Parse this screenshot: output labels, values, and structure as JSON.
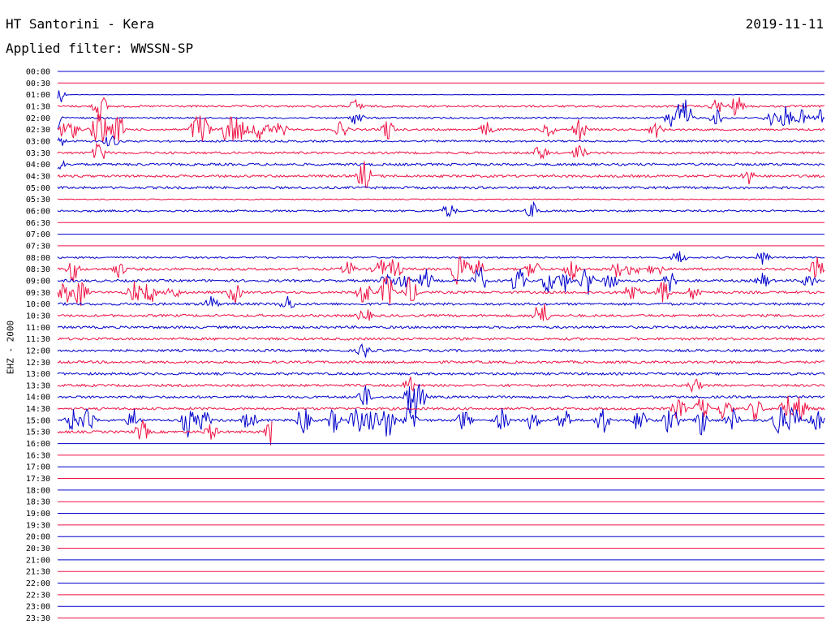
{
  "header": {
    "station": "HT Santorini - Kera",
    "date": "2019-11-11",
    "filter": "Applied filter: WWSSN-SP",
    "channel": "EHZ - 2000"
  },
  "colors": {
    "even_hour": "#0000cc",
    "half_hour": "#ee1144"
  },
  "chart_data": {
    "type": "line",
    "title": "HT Santorini - Kera",
    "subtitle": "Applied filter: WWSSN-SP",
    "date": "2019-11-11",
    "ylabel": "EHZ - 2000",
    "grid": false,
    "time_labels": [
      "00:00",
      "00:30",
      "01:00",
      "01:30",
      "02:00",
      "02:30",
      "03:00",
      "03:30",
      "04:00",
      "04:30",
      "05:00",
      "05:30",
      "06:00",
      "06:30",
      "07:00",
      "07:30",
      "08:00",
      "08:30",
      "09:00",
      "09:30",
      "10:00",
      "10:30",
      "11:00",
      "11:30",
      "12:00",
      "12:30",
      "13:00",
      "13:30",
      "14:00",
      "14:30",
      "15:00",
      "15:30",
      "16:00",
      "16:30",
      "17:00",
      "17:30",
      "18:00",
      "18:30",
      "19:00",
      "19:30",
      "20:00",
      "20:30",
      "21:00",
      "21:30",
      "22:00",
      "22:30",
      "23:00",
      "23:30"
    ],
    "series": [
      {
        "amplitude": 0,
        "events": []
      },
      {
        "amplitude": 0,
        "events": []
      },
      {
        "amplitude": 0.3,
        "events": [
          [
            0.0,
            3
          ]
        ]
      },
      {
        "amplitude": 1.2,
        "events": [
          [
            0.055,
            4
          ],
          [
            0.39,
            2
          ],
          [
            0.86,
            2
          ],
          [
            0.885,
            3
          ]
        ]
      },
      {
        "amplitude": 1.0,
        "events": [
          [
            0.0,
            3
          ],
          [
            0.39,
            2
          ],
          [
            0.8,
            2.5
          ],
          [
            0.81,
            3
          ],
          [
            0.82,
            4
          ],
          [
            0.86,
            2
          ],
          [
            0.93,
            2
          ],
          [
            0.95,
            3
          ],
          [
            0.97,
            2
          ],
          [
            0.995,
            2.5
          ]
        ]
      },
      {
        "amplitude": 1.2,
        "events": [
          [
            0.005,
            2
          ],
          [
            0.02,
            2
          ],
          [
            0.05,
            3
          ],
          [
            0.06,
            4
          ],
          [
            0.08,
            4
          ],
          [
            0.18,
            3
          ],
          [
            0.19,
            4
          ],
          [
            0.22,
            3
          ],
          [
            0.23,
            3
          ],
          [
            0.24,
            2
          ],
          [
            0.26,
            2
          ],
          [
            0.27,
            2
          ],
          [
            0.29,
            2
          ],
          [
            0.37,
            2
          ],
          [
            0.43,
            3
          ],
          [
            0.56,
            2
          ],
          [
            0.64,
            2
          ],
          [
            0.68,
            3
          ],
          [
            0.78,
            2
          ]
        ]
      },
      {
        "amplitude": 1.2,
        "events": [
          [
            0.0,
            3
          ],
          [
            0.07,
            2
          ]
        ]
      },
      {
        "amplitude": 1.4,
        "events": [
          [
            0.055,
            3
          ],
          [
            0.63,
            2
          ],
          [
            0.68,
            2
          ]
        ]
      },
      {
        "amplitude": 1.5,
        "events": [
          [
            0.0,
            2
          ]
        ]
      },
      {
        "amplitude": 1.5,
        "events": [
          [
            0.4,
            4
          ],
          [
            0.9,
            2
          ]
        ]
      },
      {
        "amplitude": 1.5,
        "events": []
      },
      {
        "amplitude": 0.6,
        "events": []
      },
      {
        "amplitude": 1.2,
        "events": [
          [
            0.51,
            2
          ],
          [
            0.62,
            2
          ]
        ]
      },
      {
        "amplitude": 0,
        "events": []
      },
      {
        "amplitude": 0,
        "events": []
      },
      {
        "amplitude": 0,
        "events": []
      },
      {
        "amplitude": 1.0,
        "events": [
          [
            0.81,
            2
          ],
          [
            0.92,
            2
          ]
        ]
      },
      {
        "amplitude": 1.5,
        "events": [
          [
            0.02,
            3
          ],
          [
            0.08,
            2
          ],
          [
            0.38,
            2
          ],
          [
            0.42,
            3
          ],
          [
            0.44,
            3
          ],
          [
            0.52,
            3
          ],
          [
            0.53,
            3
          ],
          [
            0.55,
            2
          ],
          [
            0.62,
            3
          ],
          [
            0.67,
            3
          ],
          [
            0.73,
            2
          ],
          [
            0.75,
            2
          ],
          [
            0.78,
            2
          ],
          [
            0.99,
            3
          ]
        ]
      },
      {
        "amplitude": 1.5,
        "events": [
          [
            0.43,
            2
          ],
          [
            0.45,
            3
          ],
          [
            0.48,
            3
          ],
          [
            0.55,
            4
          ],
          [
            0.6,
            4
          ],
          [
            0.64,
            3
          ],
          [
            0.66,
            3
          ],
          [
            0.69,
            4
          ],
          [
            0.72,
            3
          ],
          [
            0.8,
            3
          ],
          [
            0.92,
            2
          ],
          [
            0.98,
            2
          ]
        ]
      },
      {
        "amplitude": 1.5,
        "events": [
          [
            0.01,
            3
          ],
          [
            0.03,
            4
          ],
          [
            0.1,
            3
          ],
          [
            0.12,
            3
          ],
          [
            0.15,
            2
          ],
          [
            0.23,
            3
          ],
          [
            0.4,
            4
          ],
          [
            0.43,
            5
          ],
          [
            0.46,
            4
          ],
          [
            0.75,
            4
          ],
          [
            0.79,
            3
          ],
          [
            0.83,
            2
          ]
        ]
      },
      {
        "amplitude": 1.5,
        "events": [
          [
            0.2,
            2
          ],
          [
            0.3,
            2
          ]
        ]
      },
      {
        "amplitude": 1.5,
        "events": [
          [
            0.4,
            2
          ],
          [
            0.63,
            5
          ]
        ]
      },
      {
        "amplitude": 1.5,
        "events": []
      },
      {
        "amplitude": 1.5,
        "events": []
      },
      {
        "amplitude": 1.5,
        "events": [
          [
            0.4,
            2
          ]
        ]
      },
      {
        "amplitude": 1.5,
        "events": []
      },
      {
        "amplitude": 1.5,
        "events": []
      },
      {
        "amplitude": 1.5,
        "events": [
          [
            0.46,
            2
          ],
          [
            0.83,
            2
          ]
        ]
      },
      {
        "amplitude": 1.5,
        "events": [
          [
            0.4,
            3
          ],
          [
            0.46,
            4
          ],
          [
            0.47,
            5
          ]
        ]
      },
      {
        "amplitude": 1.5,
        "events": [
          [
            0.81,
            3
          ],
          [
            0.84,
            3
          ],
          [
            0.87,
            3
          ],
          [
            0.91,
            3
          ],
          [
            0.95,
            4
          ],
          [
            0.97,
            4
          ]
        ]
      },
      {
        "amplitude": 1.5,
        "events": [
          [
            0.02,
            3
          ],
          [
            0.04,
            4
          ],
          [
            0.1,
            3
          ],
          [
            0.17,
            4
          ],
          [
            0.19,
            3
          ],
          [
            0.25,
            3
          ],
          [
            0.32,
            4
          ],
          [
            0.36,
            3
          ],
          [
            0.39,
            4
          ],
          [
            0.41,
            4
          ],
          [
            0.43,
            5
          ],
          [
            0.46,
            4
          ],
          [
            0.53,
            3
          ],
          [
            0.58,
            3
          ],
          [
            0.62,
            3
          ],
          [
            0.66,
            4
          ],
          [
            0.71,
            4
          ],
          [
            0.76,
            4
          ],
          [
            0.8,
            5
          ],
          [
            0.84,
            4
          ],
          [
            0.88,
            3
          ],
          [
            0.94,
            5
          ],
          [
            0.96,
            4
          ],
          [
            0.99,
            3
          ]
        ]
      },
      {
        "amplitude": 1.5,
        "end": 0.28,
        "events": [
          [
            0.11,
            3
          ],
          [
            0.2,
            2
          ],
          [
            0.28,
            4
          ]
        ]
      },
      {
        "amplitude": 0,
        "events": []
      },
      {
        "amplitude": 0,
        "events": []
      },
      {
        "amplitude": 0,
        "events": []
      },
      {
        "amplitude": 0,
        "events": []
      },
      {
        "amplitude": 0,
        "events": []
      },
      {
        "amplitude": 0,
        "events": []
      },
      {
        "amplitude": 0,
        "events": []
      },
      {
        "amplitude": 0,
        "events": []
      },
      {
        "amplitude": 0,
        "events": []
      },
      {
        "amplitude": 0,
        "events": []
      },
      {
        "amplitude": 0,
        "events": []
      },
      {
        "amplitude": 0,
        "events": []
      },
      {
        "amplitude": 0,
        "events": []
      },
      {
        "amplitude": 0,
        "events": []
      },
      {
        "amplitude": 0,
        "events": []
      },
      {
        "amplitude": 0,
        "events": []
      }
    ]
  }
}
